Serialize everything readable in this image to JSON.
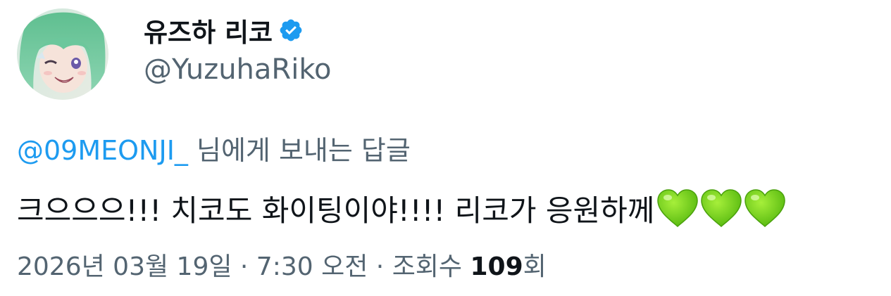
{
  "author": {
    "display_name": "유즈하 리코",
    "handle": "@YuzuhaRiko",
    "verified": true,
    "avatar_icon": "anime-girl-avatar",
    "verified_icon": "verified-badge-icon"
  },
  "reply": {
    "mention": "@09MEONJI_",
    "suffix": " 님에게 보내는 답글"
  },
  "tweet": {
    "text": "크으으으!!! 치코도 화이팅이야!!!! 리코가 응원하께",
    "emoji": [
      "green-heart-icon",
      "green-heart-icon",
      "green-heart-icon"
    ]
  },
  "meta": {
    "date_time": "2026년 03월 19일 · 7:30 오전",
    "separator": " · ",
    "views_label_prefix": "조회수 ",
    "views_count": "109",
    "views_label_suffix": "회"
  },
  "colors": {
    "accent": "#1d9bf0",
    "text_primary": "#0f1419",
    "text_secondary": "#536471",
    "heart_green": "#76d11a"
  }
}
